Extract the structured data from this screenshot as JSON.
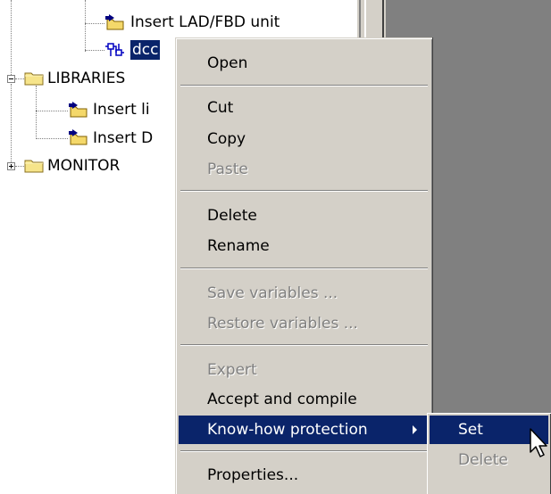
{
  "tree": {
    "items": [
      {
        "id": "insert-lad",
        "label": "Insert LAD/FBD unit",
        "icon": "insert-icon"
      },
      {
        "id": "dcc",
        "label": "dcc",
        "icon": "dcc-block-icon",
        "selected": true
      },
      {
        "id": "libraries",
        "label": "LIBRARIES",
        "icon": "folder-icon",
        "expander": "minus"
      },
      {
        "id": "insert-library",
        "label": "Insert li",
        "icon": "insert-icon"
      },
      {
        "id": "insert-dcc",
        "label": "Insert D",
        "icon": "insert-icon"
      },
      {
        "id": "monitor",
        "label": "MONITOR",
        "icon": "folder-icon",
        "expander": "plus"
      }
    ]
  },
  "context_menu": {
    "open": "Open",
    "cut": "Cut",
    "copy": "Copy",
    "paste": "Paste",
    "delete": "Delete",
    "rename": "Rename",
    "save_variables": "Save variables ...",
    "restore_variables": "Restore variables ...",
    "expert": "Expert",
    "accept_compile": "Accept and compile",
    "know_how": "Know-how protection",
    "properties": "Properties..."
  },
  "submenu": {
    "set": "Set",
    "delete": "Delete"
  },
  "colors": {
    "highlight": "#0a246a",
    "menu_bg": "#d4d0c8",
    "workarea": "#808080",
    "disabled_text": "#808080"
  }
}
